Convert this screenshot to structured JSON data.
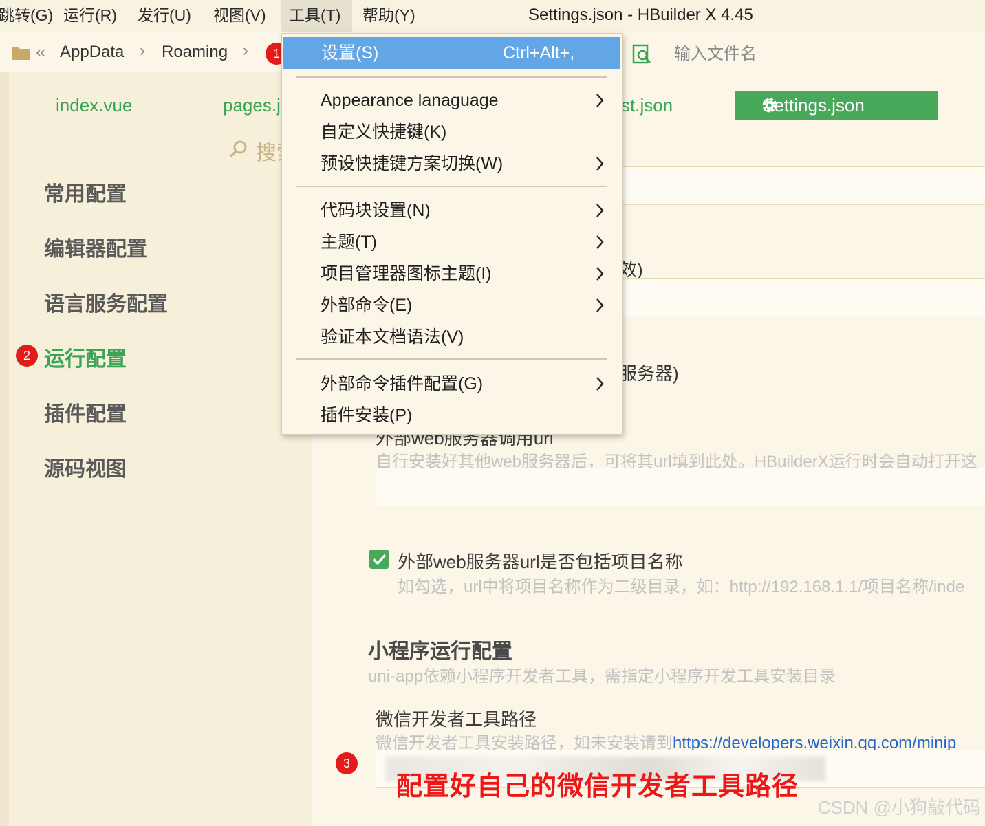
{
  "window_title": "Settings.json - HBuilder X 4.45",
  "menubar": {
    "items": [
      "跳转(G)",
      "运行(R)",
      "发行(U)",
      "视图(V)",
      "工具(T)",
      "帮助(Y)"
    ],
    "active": "工具(T)"
  },
  "addressbar": {
    "crumbs": [
      "AppData",
      "Roaming"
    ],
    "search_placeholder": "输入文件名"
  },
  "tabs": {
    "index": "index.vue",
    "pages": "pages.j",
    "manifest": "st.json",
    "settings": "Settings.json"
  },
  "settings_search": "搜索",
  "sidebar": {
    "items": [
      "常用配置",
      "编辑器配置",
      "语言服务配置",
      "运行配置",
      "插件配置",
      "源码视图"
    ],
    "active": "运行配置"
  },
  "badges": {
    "one": "1",
    "two": "2",
    "three": "3"
  },
  "dropdown": {
    "items": [
      {
        "label": "设置(S)",
        "shortcut": "Ctrl+Alt+,",
        "submenu": false,
        "highlighted": true
      },
      {
        "label": "Appearance lanaguage",
        "submenu": true
      },
      {
        "label": "自定义快捷键(K)",
        "submenu": false
      },
      {
        "label": "预设快捷键方案切换(W)",
        "submenu": true
      },
      {
        "label": "代码块设置(N)",
        "submenu": true
      },
      {
        "label": "主题(T)",
        "submenu": true
      },
      {
        "label": "项目管理器图标主题(I)",
        "submenu": true
      },
      {
        "label": "外部命令(E)",
        "submenu": true
      },
      {
        "label": "验证本文档语法(V)",
        "submenu": false
      },
      {
        "label": "外部命令插件配置(G)",
        "submenu": true
      },
      {
        "label": "插件安装(P)",
        "submenu": false
      }
    ]
  },
  "content": {
    "fragment_a": "效)",
    "fragment_b": "服务器)",
    "web_url_label": "外部web服务器调用url",
    "web_url_hint": "自行安装好其他web服务器后，可将其url填到此处。HBuilderX运行时会自动打开这",
    "include_project_label": "外部web服务器url是否包括项目名称",
    "include_project_checked": true,
    "include_project_hint": "如勾选，url中将项目名称作为二级目录，如：http://192.168.1.1/项目名称/inde",
    "mp_section_title": "小程序运行配置",
    "mp_section_hint": "uni-app依赖小程序开发者工具，需指定小程序开发工具安装目录",
    "wechat_label": "微信开发者工具路径",
    "wechat_hint_prefix": "微信开发者工具安装路径，如未安装请到",
    "wechat_hint_link": "https://developers.weixin.qq.com/minip"
  },
  "annotation_text": "配置好自己的微信开发者工具路径",
  "watermark": "CSDN @小狗敲代码",
  "colors": {
    "accent_green": "#48a95b",
    "menu_highlight": "#62a6e6",
    "badge_red": "#e31b1b",
    "annotation_red": "#f01616",
    "link_blue": "#2366c5"
  }
}
